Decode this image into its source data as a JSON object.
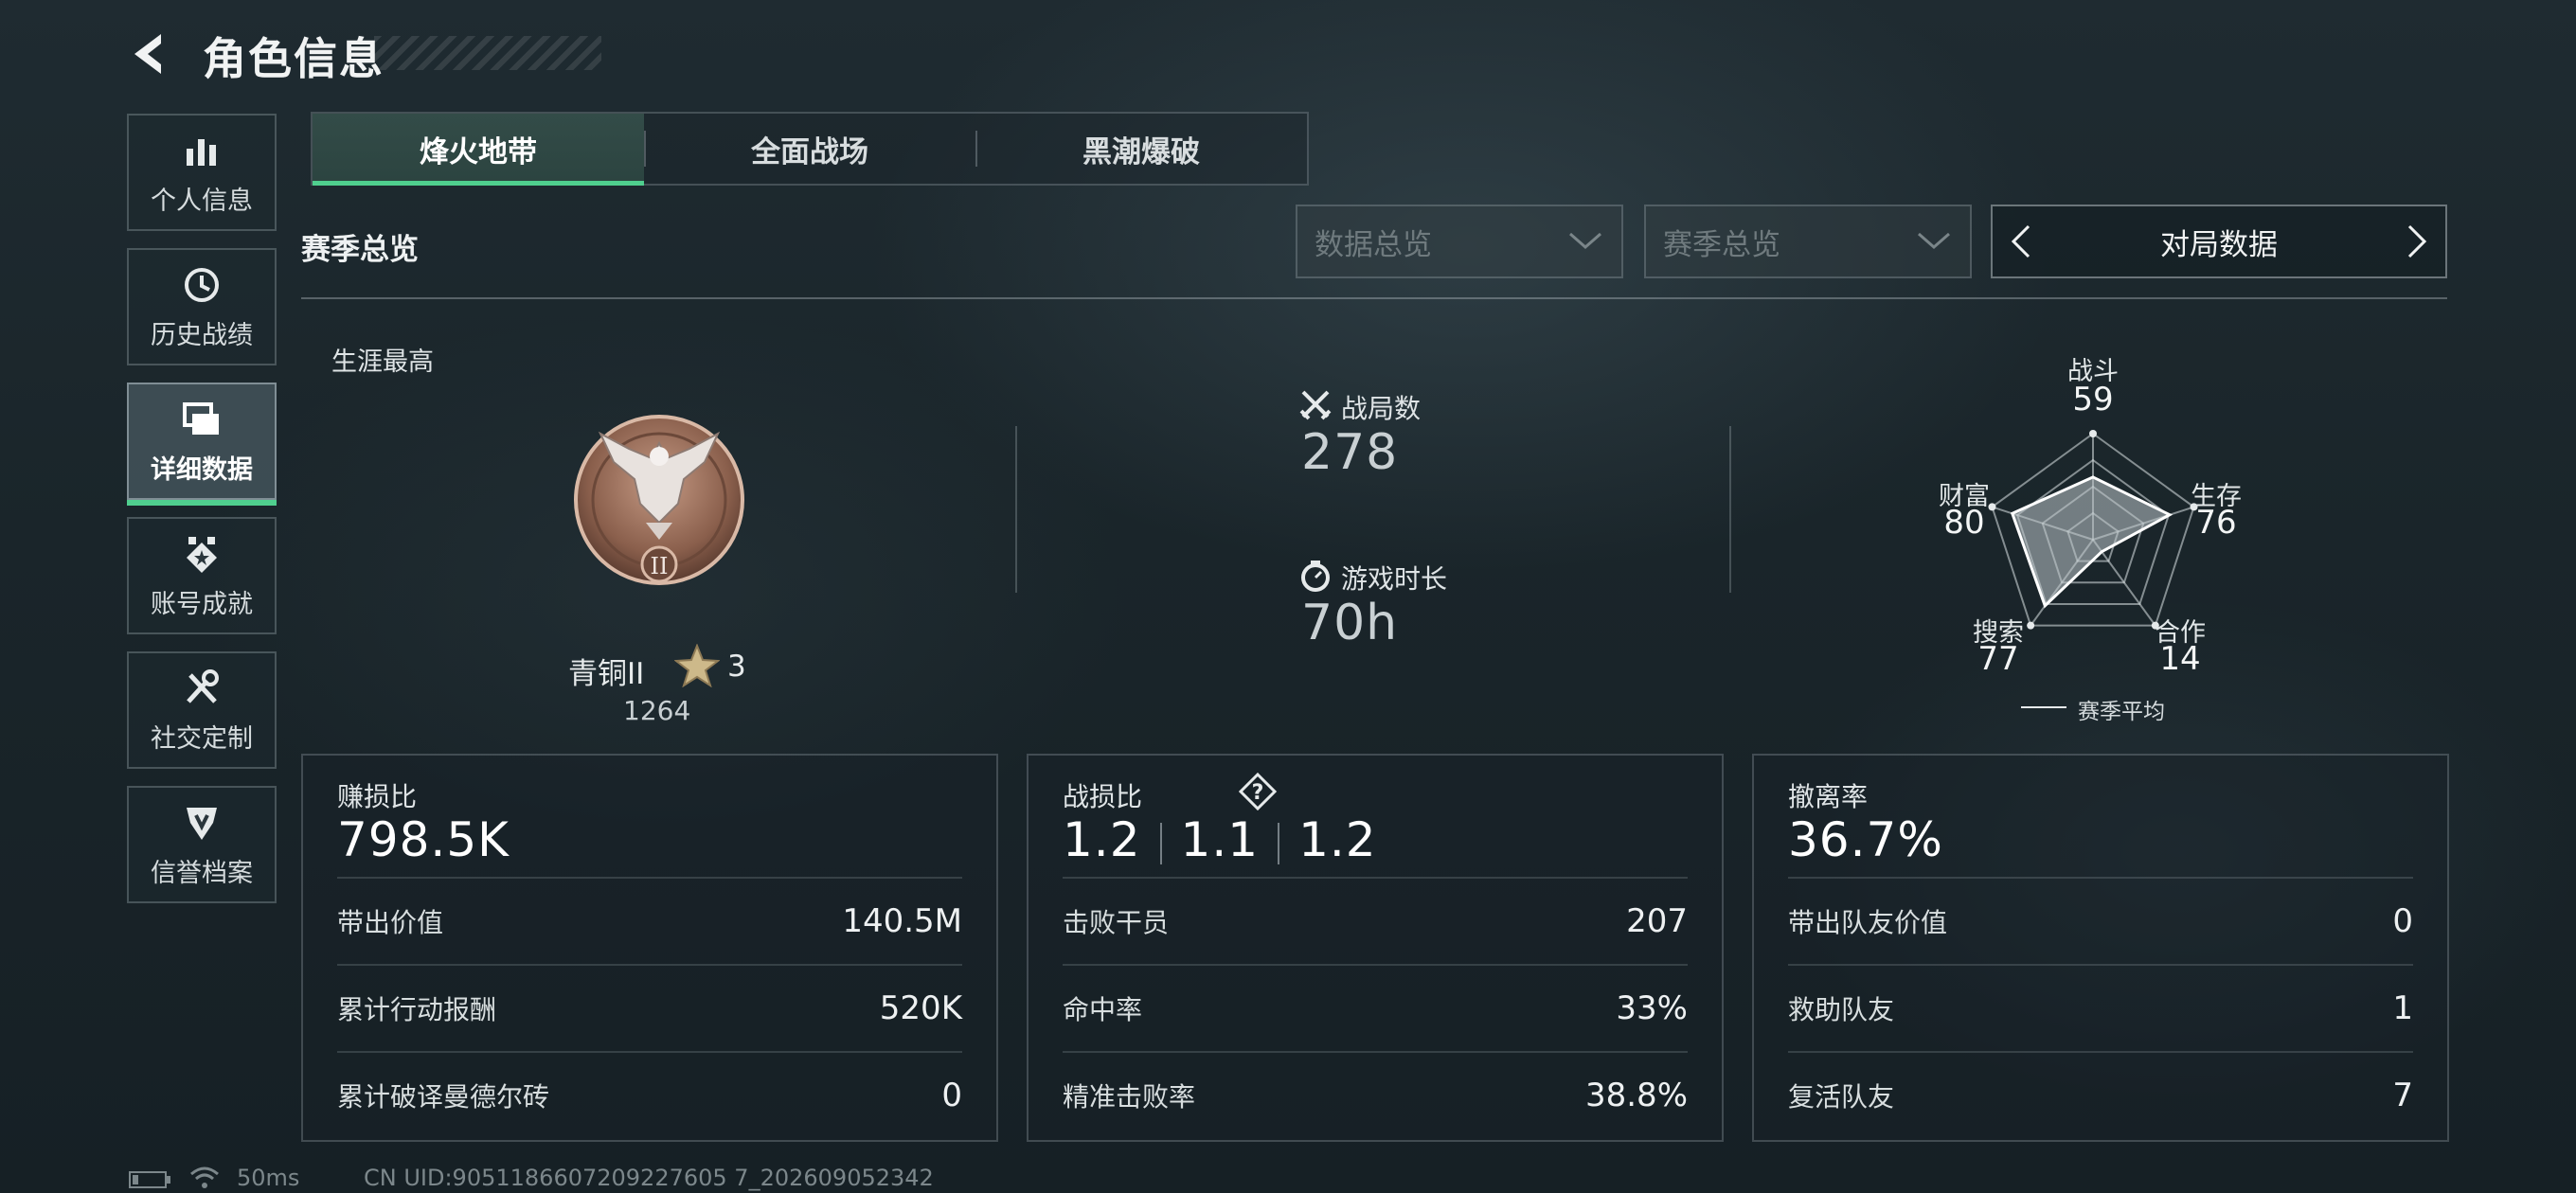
{
  "header": {
    "title": "角色信息"
  },
  "sidebar": {
    "items": [
      {
        "label": "个人信息",
        "icon": "bar-chart-icon"
      },
      {
        "label": "历史战绩",
        "icon": "history-clock-icon"
      },
      {
        "label": "详细数据",
        "icon": "stacked-cards-icon",
        "active": true
      },
      {
        "label": "账号成就",
        "icon": "achievement-badge-icon"
      },
      {
        "label": "社交定制",
        "icon": "tools-icon"
      },
      {
        "label": "信誉档案",
        "icon": "shield-badge-icon"
      }
    ]
  },
  "mode_tabs": [
    {
      "label": "烽火地带",
      "active": true
    },
    {
      "label": "全面战场"
    },
    {
      "label": "黑潮爆破"
    }
  ],
  "section": {
    "title": "赛季总览",
    "dropdown_1": "数据总览",
    "dropdown_2": "赛季总览",
    "pager_label": "对局数据"
  },
  "career": {
    "title": "生涯最高",
    "rank_name": "青铜II",
    "rank_stars": "3",
    "rank_score": "1264",
    "medal_numeral": "II"
  },
  "summary": {
    "matches_label": "战局数",
    "matches_value": "278",
    "playtime_label": "游戏时长",
    "playtime_value": "70h"
  },
  "radar": {
    "axes": [
      {
        "label": "战斗",
        "value": "59"
      },
      {
        "label": "生存",
        "value": "76"
      },
      {
        "label": "合作",
        "value": "14"
      },
      {
        "label": "搜索",
        "value": "77"
      },
      {
        "label": "财富",
        "value": "80"
      }
    ],
    "legend": "赛季平均"
  },
  "cards": {
    "profit": {
      "label": "赚损比",
      "big": "798.5K",
      "rows": [
        {
          "k": "带出价值",
          "v": "140.5M"
        },
        {
          "k": "累计行动报酬",
          "v": "520K"
        },
        {
          "k": "累计破译曼德尔砖",
          "v": "0"
        }
      ]
    },
    "combat": {
      "label": "战损比",
      "ratios": [
        "1.2",
        "1.1",
        "1.2"
      ],
      "rows": [
        {
          "k": "击败干员",
          "v": "207"
        },
        {
          "k": "命中率",
          "v": "33%"
        },
        {
          "k": "精准击败率",
          "v": "38.8%"
        }
      ]
    },
    "extract": {
      "label": "撤离率",
      "big": "36.7%",
      "rows": [
        {
          "k": "带出队友价值",
          "v": "0"
        },
        {
          "k": "救助队友",
          "v": "1"
        },
        {
          "k": "复活队友",
          "v": "7"
        }
      ]
    }
  },
  "footer": {
    "ping": "50ms",
    "uid": "CN UID:9051186607209227605 7_202609052342"
  }
}
